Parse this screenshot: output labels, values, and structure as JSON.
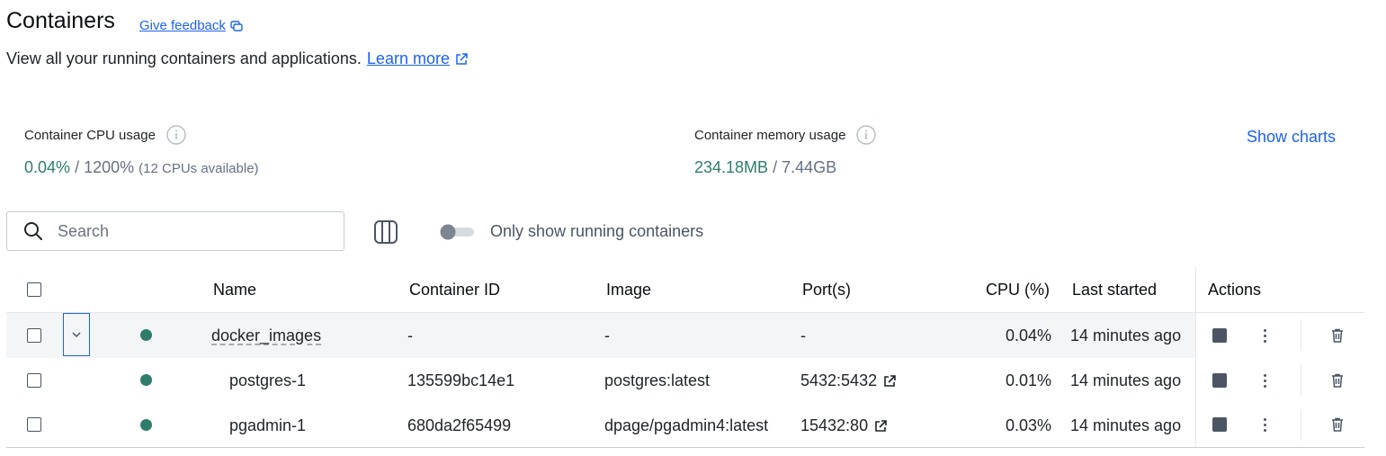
{
  "header": {
    "title": "Containers",
    "feedback_label": "Give feedback",
    "subtitle": "View all your running containers and applications.",
    "learn_more": "Learn more"
  },
  "stats": {
    "cpu": {
      "label": "Container CPU usage",
      "value": "0.04%",
      "separator": "/ 1200%",
      "note": "(12 CPUs available)"
    },
    "memory": {
      "label": "Container memory usage",
      "value": "234.18MB",
      "separator": "/ 7.44GB"
    },
    "show_charts": "Show charts"
  },
  "toolbar": {
    "search_placeholder": "Search",
    "toggle_label": "Only show running containers",
    "toggle_on": false
  },
  "table": {
    "headers": {
      "name": "Name",
      "container_id": "Container ID",
      "image": "Image",
      "ports": "Port(s)",
      "cpu": "CPU (%)",
      "last_started": "Last started",
      "actions": "Actions"
    },
    "rows": [
      {
        "name": "docker_images",
        "container_id": "-",
        "image": "-",
        "ports": "-",
        "cpu": "0.04%",
        "last_started": "14 minutes ago"
      },
      {
        "name": "postgres-1",
        "container_id": "135599bc14e1",
        "image": "postgres:latest",
        "ports": "5432:5432",
        "cpu": "0.01%",
        "last_started": "14 minutes ago"
      },
      {
        "name": "pgadmin-1",
        "container_id": "680da2f65499",
        "image": "dpage/pgadmin4:latest",
        "ports": "15432:80",
        "cpu": "0.03%",
        "last_started": "14 minutes ago"
      }
    ]
  },
  "colors": {
    "accent": "#1d63ed",
    "running": "#2e7d6b"
  }
}
